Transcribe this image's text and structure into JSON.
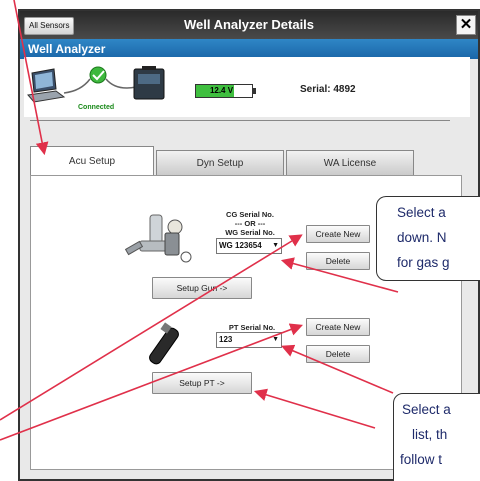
{
  "window": {
    "title": "Well Analyzer Details",
    "all_sensors_label": "All Sensors",
    "close_symbol": "✕"
  },
  "header": {
    "title": "Well Analyzer"
  },
  "status": {
    "connection": "Connected",
    "battery": "12.4 V",
    "battery_level_fraction": 0.68,
    "serial": "Serial: 4892"
  },
  "tabs": [
    {
      "label": "Acu Setup",
      "active": true
    },
    {
      "label": "Dyn Setup",
      "active": false
    },
    {
      "label": "WA License",
      "active": false
    }
  ],
  "gun": {
    "cg_label": "CG Serial No.",
    "or_label": "--- OR ---",
    "wg_label": "WG Serial No.",
    "selected": "WG 123654",
    "create_new": "Create New",
    "delete": "Delete",
    "setup": "Setup Gun ->"
  },
  "pt": {
    "label": "PT Serial No.",
    "selected": "123",
    "create_new": "Create New",
    "delete": "Delete",
    "setup": "Setup PT ->"
  },
  "callouts": {
    "first": [
      "Select a",
      "down. N",
      "for gas g"
    ],
    "second": [
      "Select a",
      "list, th",
      "follow t"
    ]
  },
  "colors": {
    "title_bar": "#3a3a3a",
    "header_blue": "#1f72b6",
    "battery_green": "#3fbf3f",
    "arrow_red": "#e0304a",
    "callout_text": "#1e2a6a"
  },
  "icons": {
    "laptop": "laptop-icon",
    "connected": "check-circle-icon",
    "analyzer_case": "analyzer-case-icon",
    "gas_gun": "gas-gun-icon",
    "pressure_transducer": "pressure-transducer-icon"
  }
}
